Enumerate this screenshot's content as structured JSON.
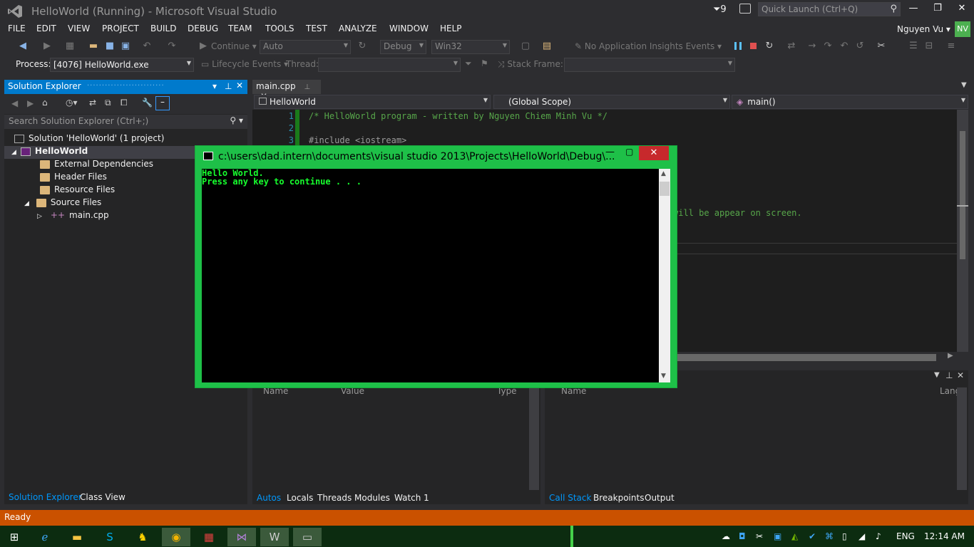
{
  "window": {
    "title": "HelloWorld (Running) - Microsoft Visual Studio",
    "filter_count": "9",
    "quick_launch_placeholder": "Quick Launch (Ctrl+Q)",
    "controls": [
      "—",
      "❐",
      "✕"
    ]
  },
  "menu": [
    "FILE",
    "EDIT",
    "VIEW",
    "PROJECT",
    "BUILD",
    "DEBUG",
    "TEAM",
    "TOOLS",
    "TEST",
    "ANALYZE",
    "WINDOW",
    "HELP"
  ],
  "user": {
    "name": "Nguyen Vu",
    "initials": "NV",
    "avatar_color": "#4cb050"
  },
  "toolbar": {
    "continue_label": "Continue",
    "auto_value": "Auto",
    "config_value": "Debug",
    "platform_value": "Win32",
    "insights_label": "No Application Insights Events"
  },
  "debug_bar": {
    "process_label": "Process:",
    "process_value": "[4076] HelloWorld.exe",
    "lifecycle_label": "Lifecycle Events",
    "thread_label": "Thread:",
    "stack_frame_label": "Stack Frame:"
  },
  "solution_explorer": {
    "title": "Solution Explorer",
    "search_placeholder": "Search Solution Explorer (Ctrl+;)",
    "solution": "Solution 'HelloWorld' (1 project)",
    "project": "HelloWorld",
    "items": [
      "External Dependencies",
      "Header Files",
      "Resource Files",
      "Source Files"
    ],
    "file": "main.cpp",
    "tabs": [
      "Solution Explorer",
      "Class View"
    ]
  },
  "editor": {
    "tab": "main.cpp",
    "nav_project": "HelloWorld",
    "nav_scope": "(Global Scope)",
    "nav_member": "main()",
    "lines": [
      {
        "num": "1",
        "text": "/* HelloWorld program - written by Nguyen Chiem Minh Vu */"
      },
      {
        "num": "2",
        "text": ""
      },
      {
        "num": "3",
        "text": "#include <iostream>"
      }
    ],
    "partial_text": "will be appear on screen."
  },
  "console": {
    "title": "c:\\users\\dad.intern\\documents\\visual studio 2013\\Projects\\HelloWorld\\Debug\\...",
    "line1": "Hello World.",
    "line2": "Press any key to continue . . ."
  },
  "autos_panel": {
    "columns": [
      "Name",
      "Value",
      "Type"
    ],
    "tabs": [
      "Autos",
      "Locals",
      "Threads",
      "Modules",
      "Watch 1"
    ]
  },
  "callstack_panel": {
    "columns": [
      "Name",
      "Lang"
    ],
    "tabs": [
      "Call Stack",
      "Breakpoints",
      "Output"
    ]
  },
  "status": {
    "text": "Ready"
  },
  "taskbar": {
    "language": "ENG",
    "time": "12:14 AM"
  }
}
